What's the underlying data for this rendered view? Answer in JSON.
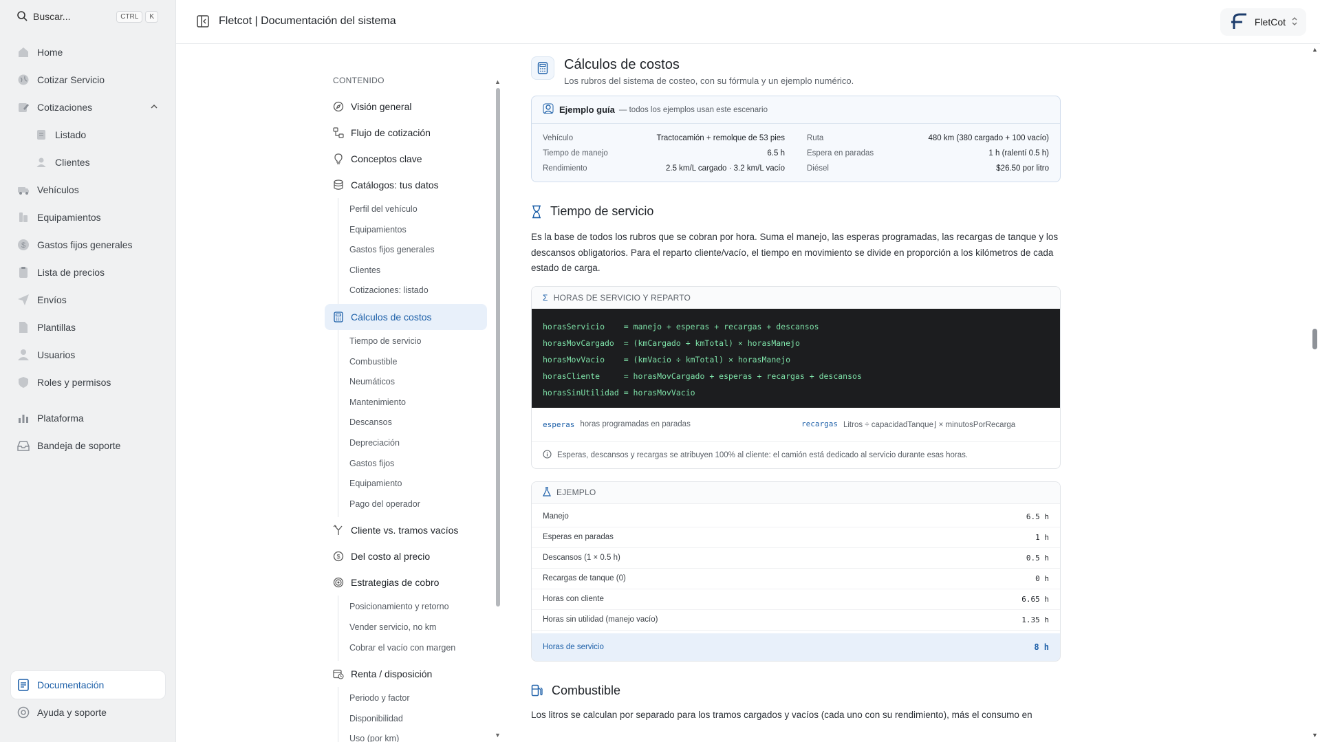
{
  "sidebar": {
    "search": {
      "label": "Buscar...",
      "kbd1": "CTRL",
      "kbd2": "K"
    },
    "items": [
      {
        "label": "Home",
        "icon": "home-icon"
      },
      {
        "label": "Cotizar Servicio",
        "icon": "globe-icon"
      },
      {
        "label": "Cotizaciones",
        "icon": "edit-icon"
      },
      {
        "label": "Listado",
        "icon": "list-icon"
      },
      {
        "label": "Clientes",
        "icon": "user-icon"
      },
      {
        "label": "Vehículos",
        "icon": "truck-icon"
      },
      {
        "label": "Equipamientos",
        "icon": "tool-icon"
      },
      {
        "label": "Gastos fijos generales",
        "icon": "dollar-icon"
      },
      {
        "label": "Lista de precios",
        "icon": "clipboard-icon"
      },
      {
        "label": "Envíos",
        "icon": "send-icon"
      },
      {
        "label": "Plantillas",
        "icon": "file-icon"
      },
      {
        "label": "Usuarios",
        "icon": "user-icon"
      },
      {
        "label": "Roles y permisos",
        "icon": "shield-icon"
      },
      {
        "label": "Plataforma",
        "icon": "chart-icon"
      },
      {
        "label": "Bandeja de soporte",
        "icon": "inbox-icon"
      }
    ],
    "bottom": [
      {
        "label": "Documentación",
        "icon": "document-icon"
      },
      {
        "label": "Ayuda y soporte",
        "icon": "lifebuoy-icon"
      }
    ]
  },
  "header": {
    "title": "Fletcot | Documentación del sistema",
    "brand": "FletCot"
  },
  "toc": {
    "heading": "CONTENIDO",
    "groups": [
      {
        "label": "Visión general",
        "subs": []
      },
      {
        "label": "Flujo de cotización",
        "subs": []
      },
      {
        "label": "Conceptos clave",
        "subs": []
      },
      {
        "label": "Catálogos: tus datos",
        "subs": [
          "Perfil del vehículo",
          "Equipamientos",
          "Gastos fijos generales",
          "Clientes",
          "Cotizaciones: listado"
        ]
      },
      {
        "label": "Cálculos de costos",
        "subs": [
          "Tiempo de servicio",
          "Combustible",
          "Neumáticos",
          "Mantenimiento",
          "Descansos",
          "Depreciación",
          "Gastos fijos",
          "Equipamiento",
          "Pago del operador"
        ]
      },
      {
        "label": "Cliente vs. tramos vacíos",
        "subs": []
      },
      {
        "label": "Del costo al precio",
        "subs": []
      },
      {
        "label": "Estrategias de cobro",
        "subs": [
          "Posicionamiento y retorno",
          "Vender servicio, no km",
          "Cobrar el vacío con margen"
        ]
      },
      {
        "label": "Renta / disposición",
        "subs": [
          "Periodo y factor",
          "Disponibilidad",
          "Uso (por km)"
        ]
      }
    ]
  },
  "content": {
    "section": {
      "title": "Cálculos de costos",
      "subtitle": "Los rubros del sistema de costeo, con su fórmula y un ejemplo numérico."
    },
    "guide": {
      "title": "Ejemplo guía",
      "note": "— todos los ejemplos usan este escenario",
      "left": [
        {
          "k": "Vehículo",
          "v": "Tractocamión + remolque de 53 pies"
        },
        {
          "k": "Tiempo de manejo",
          "v": "6.5 h"
        },
        {
          "k": "Rendimiento",
          "v": "2.5 km/L cargado · 3.2 km/L vacío"
        }
      ],
      "right": [
        {
          "k": "Ruta",
          "v": "480 km (380 cargado + 100 vacío)"
        },
        {
          "k": "Espera en paradas",
          "v": "1 h (ralentí 0.5 h)"
        },
        {
          "k": "Diésel",
          "v": "$26.50 por litro"
        }
      ]
    },
    "service": {
      "title": "Tiempo de servicio",
      "paragraph": "Es la base de todos los rubros que se cobran por hora. Suma el manejo, las esperas programadas, las recargas de tanque y los descansos obligatorios. Para el reparto cliente/vacío, el tiempo en movimiento se divide en proporción a los kilómetros de cada estado de carga.",
      "formula": {
        "title": "HORAS DE SERVICIO Y REPARTO",
        "lines": [
          "horasServicio    = manejo + esperas + recargas + descansos",
          "horasMovCargado  = (kmCargado ÷ kmTotal) × horasManejo",
          "horasMovVacio    = (kmVacio ÷ kmTotal) × horasManejo",
          "horasCliente     = horasMovCargado + esperas + recargas + descansos",
          "horasSinUtilidad = horasMovVacio"
        ],
        "vars": [
          {
            "name": "esperas",
            "desc": "horas programadas en paradas"
          },
          {
            "name": "recargas",
            "desc": "Litros ÷ capacidadTanque⌋ × minutosPorRecarga"
          }
        ],
        "note": "Esperas, descansos y recargas se atribuyen 100% al cliente: el camión está dedicado al servicio durante esas horas."
      },
      "example": {
        "title": "EJEMPLO",
        "rows": [
          {
            "k": "Manejo",
            "v": "6.5 h"
          },
          {
            "k": "Esperas en paradas",
            "v": "1 h"
          },
          {
            "k": "Descansos (1 × 0.5 h)",
            "v": "0.5 h"
          },
          {
            "k": "Recargas de tanque (0)",
            "v": "0 h"
          },
          {
            "k": "Horas con cliente",
            "v": "6.65 h"
          },
          {
            "k": "Horas sin utilidad (manejo vacío)",
            "v": "1.35 h"
          }
        ],
        "total": {
          "k": "Horas de servicio",
          "v": "8 h"
        }
      }
    },
    "fuel": {
      "title": "Combustible",
      "paragraph": "Los litros se calculan por separado para los tramos cargados y vacíos (cada uno con su rendimiento), más el consumo en"
    }
  }
}
